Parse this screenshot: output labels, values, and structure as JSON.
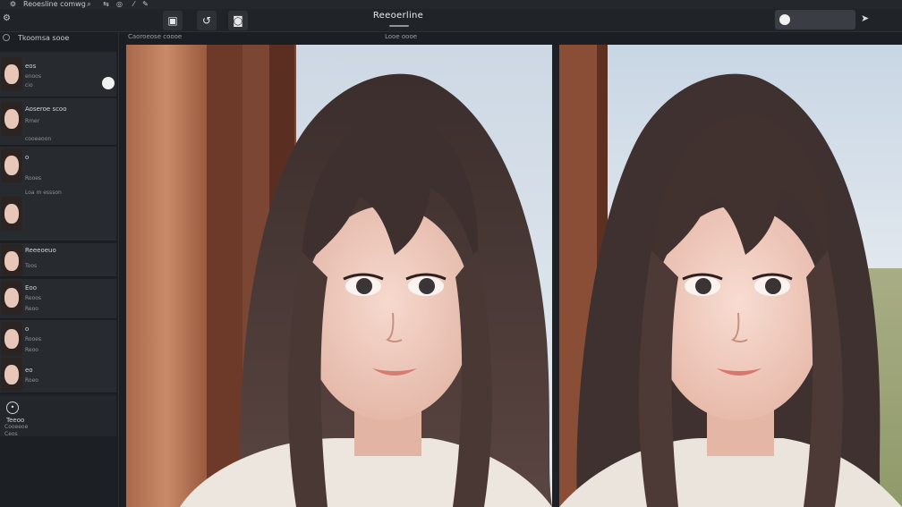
{
  "menubar": {
    "title": "Reoesline comwg",
    "icons": [
      "gear-icon",
      "search-icon",
      "swap-icon",
      "globe-icon",
      "pin-icon",
      "pen-icon"
    ]
  },
  "toolbar": {
    "title": "Reeoerline",
    "buttons": [
      {
        "name": "crop-button",
        "glyph": "▣"
      },
      {
        "name": "rotate-button",
        "glyph": "↺"
      },
      {
        "name": "view-button",
        "glyph": "◙"
      }
    ],
    "search_placeholder": "",
    "right_icon": "cursor-icon"
  },
  "sidebar": {
    "header": "Tkoomsa sooe",
    "items": [
      {
        "title": "eos",
        "sub": "enoos",
        "sub2": "cio"
      },
      {
        "title": "Aoseroe scoo",
        "sub": "Rmer",
        "sub2": "cooeeoon"
      },
      {
        "title": "o",
        "sub": "Rooes",
        "sub2": "Loa m essson"
      },
      {
        "title": "",
        "sub": "",
        "sub2": ""
      },
      {
        "title": "Reeeoeuo",
        "sub": "Toos",
        "sub2": ""
      },
      {
        "title": "Eoo",
        "sub": "Reoos",
        "sub2": "Reoo"
      },
      {
        "title": "o",
        "sub": "Rooes",
        "sub2": "Reoo"
      },
      {
        "title": "eo",
        "sub": "Roeo",
        "sub2": ""
      }
    ],
    "footer": {
      "title": "Teeoo",
      "sub": "Cooeeoe",
      "sub2": "Ceos"
    }
  },
  "views": {
    "left_label": "Caoroeose coooe",
    "right_label": "Looe oooe"
  },
  "colors": {
    "bg": "#1b1e22",
    "panel": "#272a2f",
    "accent": "#f1f1f1"
  }
}
